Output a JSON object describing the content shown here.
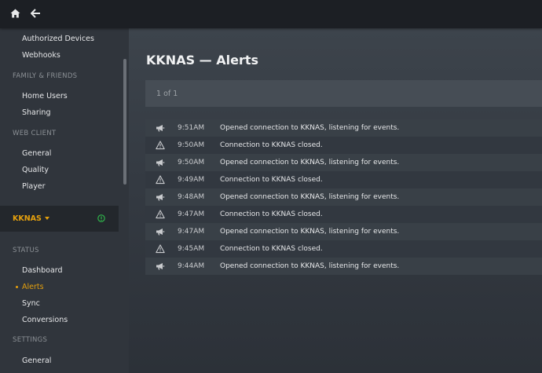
{
  "topbar": {
    "home_icon": "home-icon",
    "back_icon": "arrow-left-icon"
  },
  "sidebar": {
    "items_top": [
      {
        "label": "Authorized Devices"
      },
      {
        "label": "Webhooks"
      }
    ],
    "section_family": "FAMILY & FRIENDS",
    "family_items": [
      {
        "label": "Home Users"
      },
      {
        "label": "Sharing"
      }
    ],
    "section_web": "WEB CLIENT",
    "web_items": [
      {
        "label": "General"
      },
      {
        "label": "Quality"
      },
      {
        "label": "Player"
      }
    ],
    "server": {
      "name": "KKNAS",
      "status_icon": "server-online-icon",
      "status_color": "#2fb34a"
    },
    "section_status": "STATUS",
    "status_items": [
      {
        "label": "Dashboard"
      },
      {
        "label": "Alerts",
        "active": true
      },
      {
        "label": "Sync"
      },
      {
        "label": "Conversions"
      }
    ],
    "section_settings": "SETTINGS",
    "settings_items": [
      {
        "label": "General"
      }
    ]
  },
  "main": {
    "title": "KKNAS — Alerts",
    "pager": "1 of 1",
    "alerts": [
      {
        "type": "megaphone",
        "time": "9:51AM",
        "message": "Opened connection to KKNAS, listening for events."
      },
      {
        "type": "warning",
        "time": "9:50AM",
        "message": "Connection to KKNAS closed."
      },
      {
        "type": "megaphone",
        "time": "9:50AM",
        "message": "Opened connection to KKNAS, listening for events."
      },
      {
        "type": "warning",
        "time": "9:49AM",
        "message": "Connection to KKNAS closed."
      },
      {
        "type": "megaphone",
        "time": "9:48AM",
        "message": "Opened connection to KKNAS, listening for events."
      },
      {
        "type": "warning",
        "time": "9:47AM",
        "message": "Connection to KKNAS closed."
      },
      {
        "type": "megaphone",
        "time": "9:47AM",
        "message": "Opened connection to KKNAS, listening for events."
      },
      {
        "type": "warning",
        "time": "9:45AM",
        "message": "Connection to KKNAS closed."
      },
      {
        "type": "megaphone",
        "time": "9:44AM",
        "message": "Opened connection to KKNAS, listening for events."
      }
    ]
  },
  "colors": {
    "accent": "#e5a00d",
    "online": "#2fb34a"
  }
}
